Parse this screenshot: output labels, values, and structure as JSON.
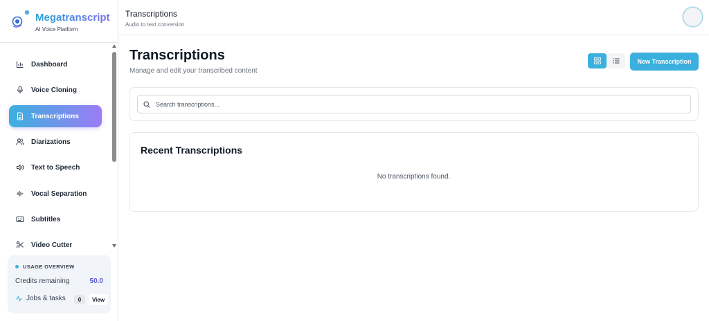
{
  "brand": {
    "name": "Megatranscript",
    "tagline": "AI Voice Platform",
    "accent_start": "#2aa3d6",
    "accent_end": "#7c6cf0"
  },
  "sidebar": {
    "items": [
      {
        "label": "Dashboard",
        "icon": "bar-chart-icon",
        "active": false
      },
      {
        "label": "Voice Cloning",
        "icon": "microphone-icon",
        "active": false
      },
      {
        "label": "Transcriptions",
        "icon": "document-icon",
        "active": true
      },
      {
        "label": "Diarizations",
        "icon": "users-icon",
        "active": false
      },
      {
        "label": "Text to Speech",
        "icon": "speaker-icon",
        "active": false
      },
      {
        "label": "Vocal Separation",
        "icon": "audio-waveform-icon",
        "active": false
      },
      {
        "label": "Subtitles",
        "icon": "captions-icon",
        "active": false
      },
      {
        "label": "Video Cutter",
        "icon": "scissors-icon",
        "active": false
      }
    ]
  },
  "usage": {
    "title": "USAGE OVERVIEW",
    "credits_label": "Credits remaining",
    "credits_value": "50.0",
    "jobs_label": "Jobs & tasks",
    "jobs_count": "0",
    "view_label": "View"
  },
  "header": {
    "title": "Transcriptions",
    "subtitle": "Audio to text conversion"
  },
  "main": {
    "title": "Transcriptions",
    "subtitle": "Manage and edit your transcribed content",
    "view_toggle": {
      "active": "grid-view-icon",
      "inactive": "list-view-icon"
    },
    "new_button": "New Transcription",
    "search": {
      "placeholder": "Search transcriptions..."
    },
    "recent": {
      "title": "Recent Transcriptions",
      "empty_message": "No transcriptions found."
    }
  },
  "colors": {
    "primary": "#3bb0de",
    "active_gradient_end": "#9b7cf5",
    "credits": "#5b5bd6"
  }
}
